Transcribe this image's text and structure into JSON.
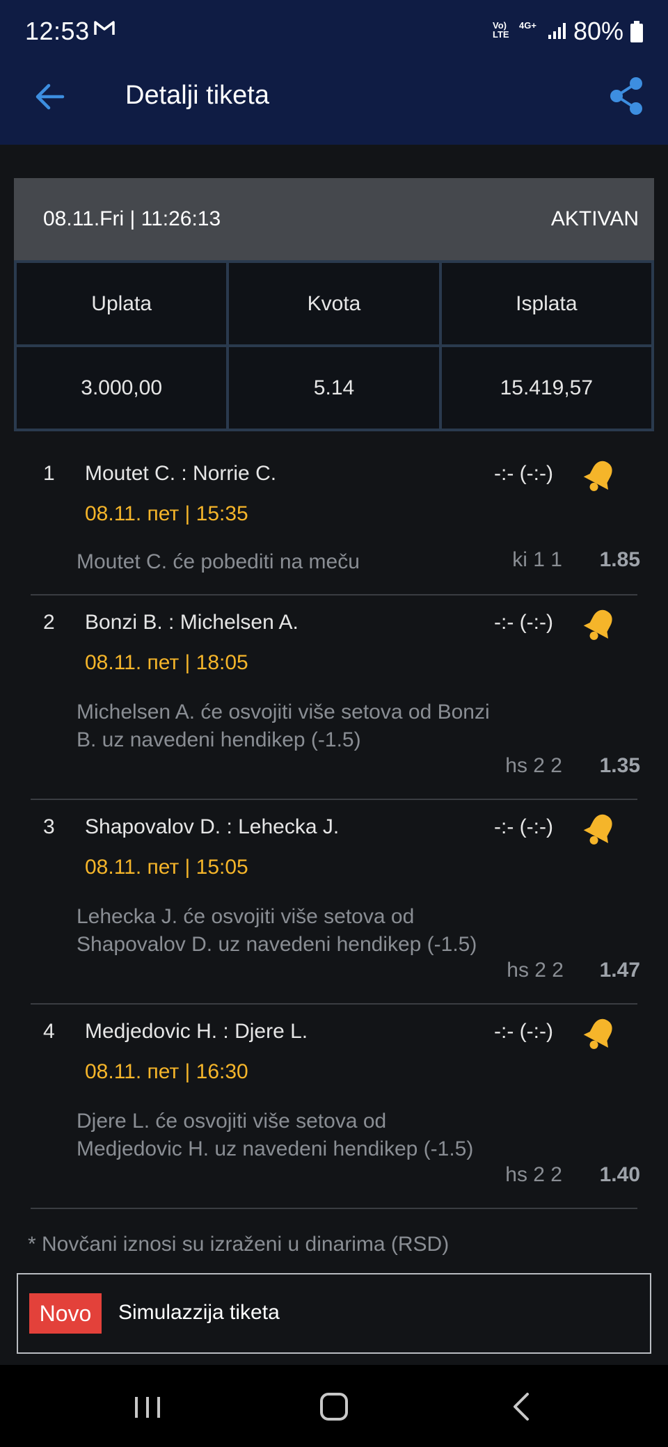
{
  "status_bar": {
    "time": "12:53",
    "network_lte": "Vo) LTE",
    "network_4g": "4G+",
    "battery": "80%"
  },
  "app_bar": {
    "title": "Detalji tiketa",
    "back_icon": "arrow-left-icon",
    "share_icon": "share-icon"
  },
  "ticket": {
    "datetime": "08.11.Fri | 11:26:13",
    "status": "AKTIVAN",
    "headers": [
      "Uplata",
      "Kvota",
      "Isplata"
    ],
    "values": [
      "3.000,00",
      "5.14",
      "15.419,57"
    ]
  },
  "matches": [
    {
      "index": "1",
      "teams": "Moutet C. : Norrie C.",
      "score": "-:- (-:-)",
      "when": "08.11. пет | 15:35",
      "description": "Moutet C. će pobediti na meču",
      "code": "ki 1 1",
      "odd": "1.85"
    },
    {
      "index": "2",
      "teams": "Bonzi B. : Michelsen A.",
      "score": "-:- (-:-)",
      "when": "08.11. пет | 18:05",
      "description": "Michelsen A. će osvojiti više setova od Bonzi B. uz navedeni hendikep (-1.5)",
      "code": "hs 2 2",
      "odd": "1.35"
    },
    {
      "index": "3",
      "teams": "Shapovalov D. : Lehecka J.",
      "score": "-:- (-:-)",
      "when": "08.11. пет | 15:05",
      "description": "Lehecka J. će osvojiti više setova od Shapovalov D. uz navedeni hendikep (-1.5)",
      "code": "hs 2 2",
      "odd": "1.47"
    },
    {
      "index": "4",
      "teams": "Medjedovic H. : Djere L.",
      "score": "-:- (-:-)",
      "when": "08.11. пет | 16:30",
      "description": "Djere L. će osvojiti više setova od Medjedovic H. uz navedeni hendikep (-1.5)",
      "code": "hs 2 2",
      "odd": "1.40"
    }
  ],
  "footnote": "* Novčani iznosi su izraženi u dinarima (RSD)",
  "simulation": {
    "badge": "Novo",
    "label": "Simulazzija tiketa"
  },
  "colors": {
    "header_bg": "#0f1c44",
    "accent": "#f5b52a",
    "badge": "#e3413a",
    "link": "#3d8ee0"
  }
}
